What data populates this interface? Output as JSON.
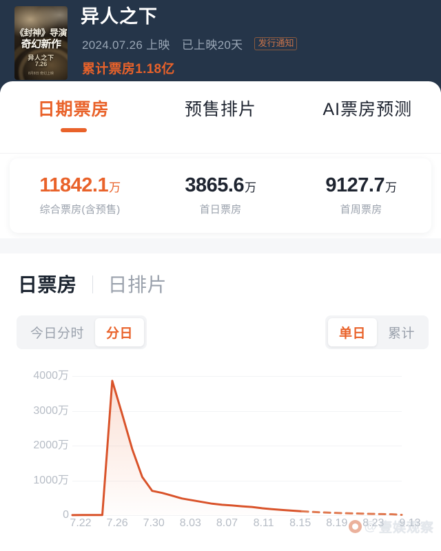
{
  "header": {
    "movie_title": "异人之下",
    "release_date": "2024.07.26 上映",
    "days_since_release": "已上映20天",
    "badge": "发行通知",
    "cumulative_box_office": "累计票房1.18亿",
    "poster": {
      "line1": "《封神》导演",
      "line2": "奇幻新作",
      "line3": "异人之下",
      "line4": "7.26",
      "line5": "8月8日 奇幻上映"
    }
  },
  "tabs": [
    {
      "label": "日期票房",
      "active": true
    },
    {
      "label": "预售排片",
      "active": false
    },
    {
      "label": "AI票房预测",
      "active": false
    }
  ],
  "stats": [
    {
      "value": "11842.1",
      "unit": "万",
      "label": "综合票房(含预售)",
      "primary": true
    },
    {
      "value": "3865.6",
      "unit": "万",
      "label": "首日票房",
      "primary": false
    },
    {
      "value": "9127.7",
      "unit": "万",
      "label": "首周票房",
      "primary": false
    }
  ],
  "section": {
    "title_active": "日票房",
    "title_inactive": "日排片",
    "left_controls": [
      {
        "label": "今日分时",
        "active": false
      },
      {
        "label": "分日",
        "active": true
      }
    ],
    "right_controls": [
      {
        "label": "单日",
        "active": true
      },
      {
        "label": "累计",
        "active": false
      }
    ]
  },
  "watermark": {
    "at": "@",
    "text": "壹娱观察"
  },
  "colors": {
    "accent": "#e9622a",
    "line": "#d9532a",
    "header_bg": "#253549",
    "muted_text": "#9aa1ac",
    "grid": "#f2f3f5"
  },
  "chart_data": {
    "type": "line",
    "title": "日票房",
    "xlabel": "",
    "ylabel": "",
    "ylim": [
      0,
      4400
    ],
    "yticks": [
      0,
      1000,
      2000,
      3000,
      4000
    ],
    "ytick_labels": [
      "0",
      "1000万",
      "2000万",
      "3000万",
      "4000万"
    ],
    "unit": "万",
    "grid": true,
    "legend": null,
    "xtick_labels": [
      "7.22",
      "7.26",
      "7.30",
      "8.03",
      "8.07",
      "8.11",
      "8.15",
      "8.19",
      "8.23",
      "9.13"
    ],
    "x": [
      "7.22",
      "7.23",
      "7.24",
      "7.25",
      "7.26",
      "7.27",
      "7.28",
      "7.29",
      "7.30",
      "7.31",
      "8.01",
      "8.02",
      "8.03",
      "8.04",
      "8.05",
      "8.06",
      "8.07",
      "8.08",
      "8.09",
      "8.10",
      "8.11",
      "8.12",
      "8.13",
      "8.14",
      "8.15",
      "8.16",
      "8.17",
      "8.18",
      "8.19",
      "8.20",
      "8.21",
      "8.22",
      "8.23",
      "9.13"
    ],
    "values": [
      2,
      3,
      4,
      6,
      3866,
      2900,
      1900,
      1100,
      700,
      640,
      560,
      480,
      430,
      380,
      330,
      300,
      280,
      255,
      235,
      200,
      175,
      150,
      130,
      110,
      95,
      82,
      70,
      60,
      52,
      45,
      38,
      32,
      28,
      10
    ],
    "solid_until_index": 23,
    "dashed_from_index": 23,
    "series_note": "solid segment = actual, dashed segment = forecast",
    "peak": {
      "x": "7.26",
      "y": 3866
    }
  }
}
